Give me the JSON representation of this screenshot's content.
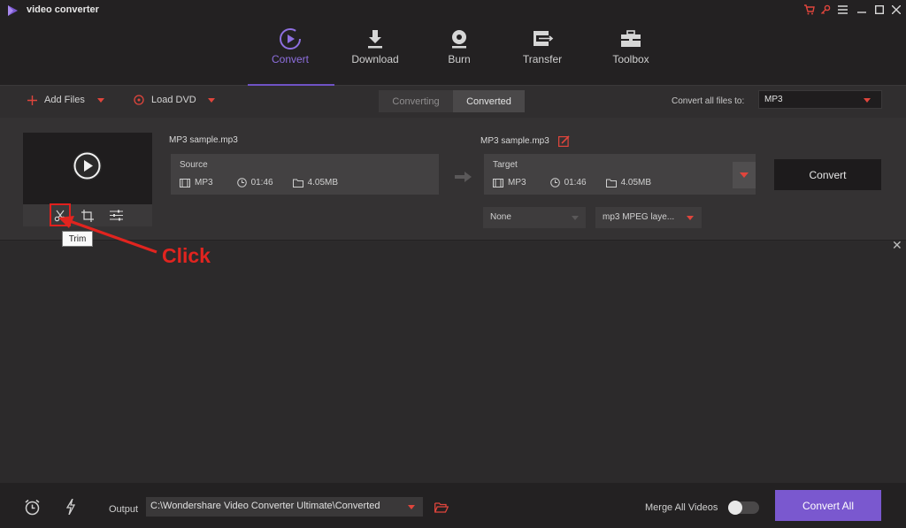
{
  "app": {
    "title": "video converter",
    "accent": "#7a58cf"
  },
  "window_controls": [
    "cart-icon",
    "key-icon",
    "menu-icon",
    "minimize-icon",
    "maximize-icon",
    "close-icon"
  ],
  "nav": {
    "tabs": [
      {
        "label": "Convert",
        "icon": "convert-icon",
        "active": true
      },
      {
        "label": "Download",
        "icon": "download-icon"
      },
      {
        "label": "Burn",
        "icon": "burn-icon"
      },
      {
        "label": "Transfer",
        "icon": "transfer-icon"
      },
      {
        "label": "Toolbox",
        "icon": "toolbox-icon"
      }
    ]
  },
  "toolbar": {
    "add_files": "Add Files",
    "load_dvd": "Load DVD",
    "segments": [
      "Converting",
      "Converted"
    ],
    "convert_all_label": "Convert all files to:",
    "format": "MP3"
  },
  "file": {
    "source_name": "MP3 sample.mp3",
    "target_name": "MP3 sample.mp3",
    "source": {
      "title": "Source",
      "format": "MP3",
      "duration": "01:46",
      "size": "4.05MB"
    },
    "target": {
      "title": "Target",
      "format": "MP3",
      "duration": "01:46",
      "size": "4.05MB"
    },
    "convert_button": "Convert",
    "subtitle_select": "None",
    "audio_select": "mp3 MPEG laye...",
    "tools": [
      "trim-icon",
      "crop-icon",
      "effects-icon"
    ]
  },
  "annotation": {
    "tooltip": "Trim",
    "click_label": "Click",
    "color": "#e1241f"
  },
  "bottom": {
    "output_label": "Output",
    "output_path": "C:\\Wondershare Video Converter Ultimate\\Converted",
    "merge_label": "Merge All Videos",
    "merge_enabled": false,
    "convert_all": "Convert All"
  }
}
